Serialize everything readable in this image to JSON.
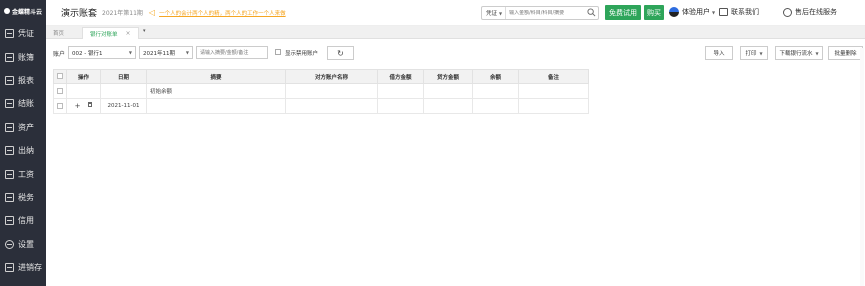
{
  "logo": {
    "text": "金蝶精斗云"
  },
  "sidebar": {
    "items": [
      {
        "label": "凭证",
        "icon": "voucher-icon"
      },
      {
        "label": "账簿",
        "icon": "ledger-icon"
      },
      {
        "label": "报表",
        "icon": "report-icon"
      },
      {
        "label": "结账",
        "icon": "close-account-icon"
      },
      {
        "label": "资产",
        "icon": "asset-icon"
      },
      {
        "label": "出纳",
        "icon": "cashier-icon"
      },
      {
        "label": "工资",
        "icon": "salary-icon"
      },
      {
        "label": "税务",
        "icon": "tax-icon"
      },
      {
        "label": "信用",
        "icon": "credit-icon"
      },
      {
        "label": "设置",
        "icon": "gear-icon"
      },
      {
        "label": "进销存",
        "icon": "inventory-icon"
      }
    ]
  },
  "header": {
    "account_title": "演示账套",
    "period": "2021年第11期",
    "notice": "一个人的会计两个人的精，两个人的工作一个人来做",
    "search": {
      "type": "凭证",
      "placeholder": "输入金额/科目/科目/摘要"
    },
    "trial_label": "免费试用",
    "buy_label": "购买",
    "user_label": "体验用户",
    "contact_label": "联系我们",
    "service_label": "售后在线服务",
    "help_label": "?",
    "exit_label": "⏻"
  },
  "tabs": {
    "home": "首页",
    "active": "银行对账单",
    "close": "×",
    "more": "▾"
  },
  "filters": {
    "account_label": "账户",
    "account_value": "002 - 银行1",
    "period_value": "2021年11期",
    "keyword_placeholder": "请输入摘要/金额/备注",
    "show_disabled_label": "显示禁用账户",
    "refresh_icon": "↻",
    "import_label": "导入",
    "print_label": "打印",
    "download_label": "下载银行流水",
    "batch_delete_label": "批量删除"
  },
  "table": {
    "columns": [
      "",
      "操作",
      "日期",
      "摘要",
      "对方账户名称",
      "借方金额",
      "贷方金额",
      "余额",
      "备注"
    ],
    "rows": [
      {
        "op_add": "",
        "op_del": "",
        "date": "",
        "summary": "初始余额",
        "counterparty": "",
        "debit": "",
        "credit": "",
        "balance": "",
        "remark": ""
      },
      {
        "op_add": "+",
        "op_del": "",
        "date": "2021-11-01",
        "summary": "",
        "counterparty": "",
        "debit": "",
        "credit": "",
        "balance": "",
        "remark": ""
      }
    ]
  },
  "colors": {
    "sidebar_bg": "#2b2f3a",
    "accent_green": "#2ea55a",
    "notice_orange": "#f5a623"
  }
}
